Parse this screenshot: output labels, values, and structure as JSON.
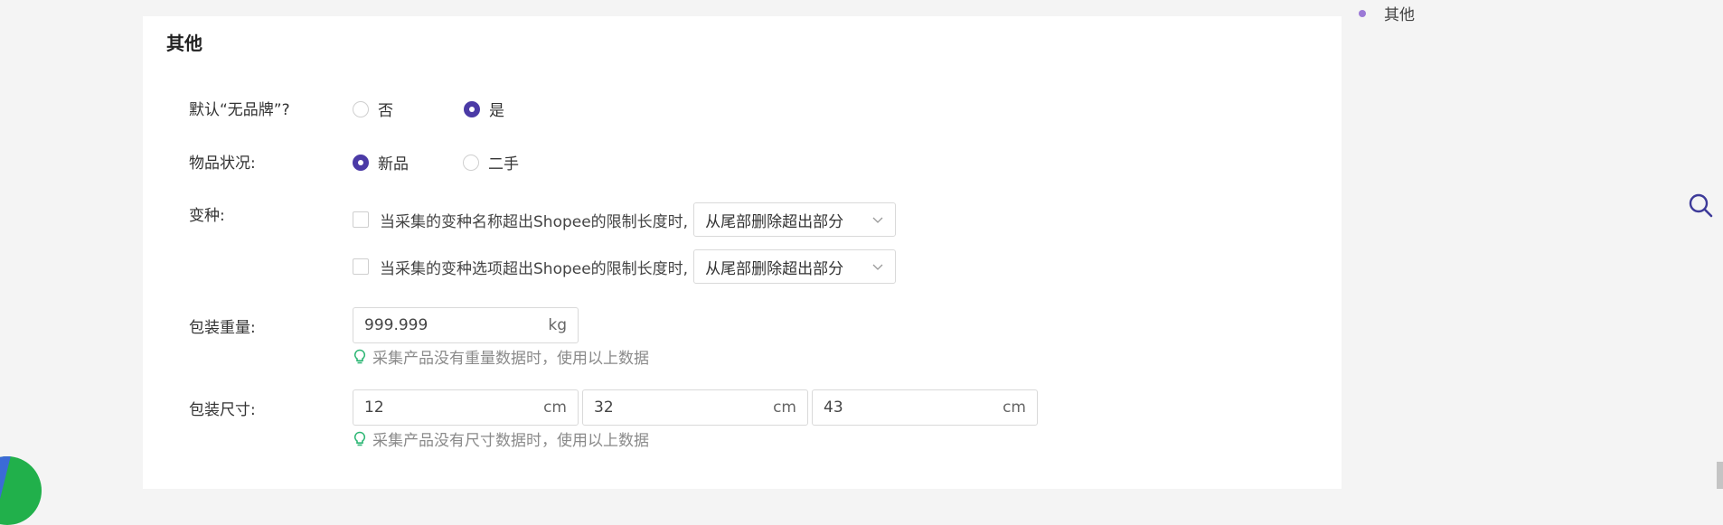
{
  "section": {
    "title": "其他"
  },
  "sidebar": {
    "items": [
      {
        "label": "其他"
      }
    ]
  },
  "fields": {
    "no_brand": {
      "label": "默认“无品牌”?",
      "options": [
        {
          "label": "否",
          "checked": false
        },
        {
          "label": "是",
          "checked": true
        }
      ]
    },
    "condition": {
      "label": "物品状况:",
      "options": [
        {
          "label": "新品",
          "checked": true
        },
        {
          "label": "二手",
          "checked": false
        }
      ]
    },
    "variant": {
      "label": "变种:",
      "rows": [
        {
          "text": "当采集的变种名称超出Shopee的限制长度时,",
          "checked": false,
          "select_value": "从尾部删除超出部分"
        },
        {
          "text": "当采集的变种选项超出Shopee的限制长度时,",
          "checked": false,
          "select_value": "从尾部删除超出部分"
        }
      ]
    },
    "weight": {
      "label": "包装重量:",
      "value": "999.999",
      "unit": "kg",
      "hint": "采集产品没有重量数据时，使用以上数据"
    },
    "size": {
      "label": "包装尺寸:",
      "values": [
        {
          "value": "12",
          "unit": "cm"
        },
        {
          "value": "32",
          "unit": "cm"
        },
        {
          "value": "43",
          "unit": "cm"
        }
      ],
      "hint": "采集产品没有尺寸数据时，使用以上数据"
    }
  },
  "colors": {
    "accent": "#4b3aa6",
    "hint_icon": "#2bb673",
    "bullet": "#9b79d6",
    "search_icon": "#3d3a99"
  },
  "icons": {
    "select_arrow": "chevron-down-icon",
    "hint": "lightbulb-icon",
    "search": "search-icon",
    "side_bullet": "dot-icon"
  }
}
